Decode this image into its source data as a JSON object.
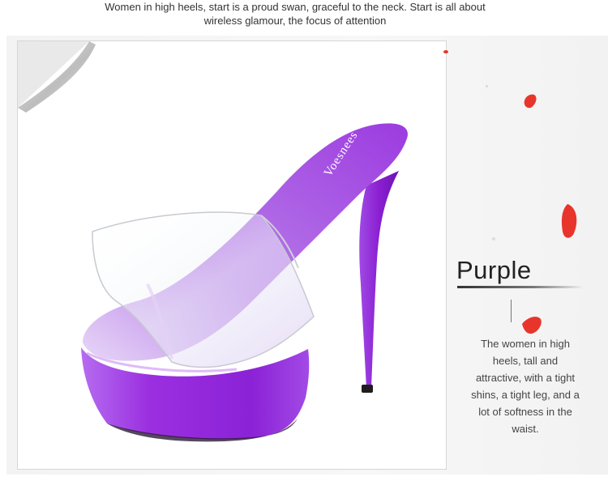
{
  "caption": {
    "line1": "Women in high heels, start is a proud swan, graceful to the neck. Start is all about",
    "line2": "wireless glamour, the focus of attention"
  },
  "product": {
    "brand_text": "Voesnees",
    "color_title": "Purple",
    "description": "The women in high heels, tall and attractive, with a tight shins, a tight leg, and a lot of softness in the waist."
  },
  "colors": {
    "accent_purple": "#9b2fe0",
    "petal_red": "#e8352c"
  },
  "icons": [
    "page-curl-icon",
    "petal-icon"
  ]
}
